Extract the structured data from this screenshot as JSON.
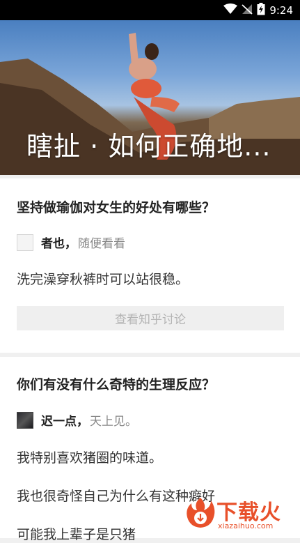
{
  "status_bar": {
    "time": "9:24",
    "icons": [
      "wifi-icon",
      "no-signal-icon",
      "battery-charging-icon"
    ]
  },
  "hero": {
    "title": "瞎扯 · 如何正确地..."
  },
  "cards": [
    {
      "question": "坚持做瑜伽对女生的好处有哪些？",
      "author_name": "者也",
      "author_sep": "，",
      "author_bio": "随便看看",
      "answer_lines": [
        "洗完澡穿秋裤时可以站很稳。"
      ],
      "discuss_button": "查看知乎讨论"
    },
    {
      "question": "你们有没有什么奇特的生理反应？",
      "author_name": "迟一点",
      "author_sep": "，",
      "author_bio": "天上见。",
      "answer_lines": [
        "我特别喜欢猪圈的味道。",
        "我也很奇怪自己为什么有这种癖好",
        "可能我上辈子是只猪"
      ]
    }
  ],
  "watermark": {
    "brand": "下载火",
    "domain": "xiazaihuo.com"
  },
  "colors": {
    "statusbar_bg": "#000000",
    "card_bg": "#ffffff",
    "page_bg": "#f0f0f0",
    "button_bg": "#efefef",
    "button_text": "#b4b4b4",
    "watermark": "#e8502a"
  }
}
